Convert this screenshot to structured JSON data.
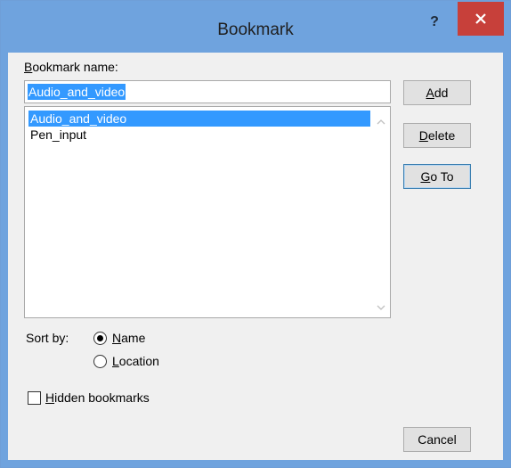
{
  "window": {
    "title": "Bookmark",
    "help_label": "?",
    "titlebar_color": "#6fa3de",
    "close_color": "#c7403a"
  },
  "form": {
    "name_label_u": "B",
    "name_label_rest": "ookmark name:",
    "name_value": "Audio_and_video"
  },
  "list": {
    "items": [
      "Audio_and_video",
      "Pen_input"
    ],
    "selected_index": 0
  },
  "buttons": {
    "add_u": "A",
    "add_rest": "dd",
    "delete_u": "D",
    "delete_rest": "elete",
    "goto_u": "G",
    "goto_rest": "o To",
    "cancel": "Cancel"
  },
  "sort": {
    "label": "Sort by:",
    "name_u": "N",
    "name_rest": "ame",
    "location_u": "L",
    "location_rest": "ocation",
    "selected": "Name"
  },
  "hidden": {
    "label_u": "H",
    "label_rest": "idden bookmarks",
    "checked": false
  }
}
